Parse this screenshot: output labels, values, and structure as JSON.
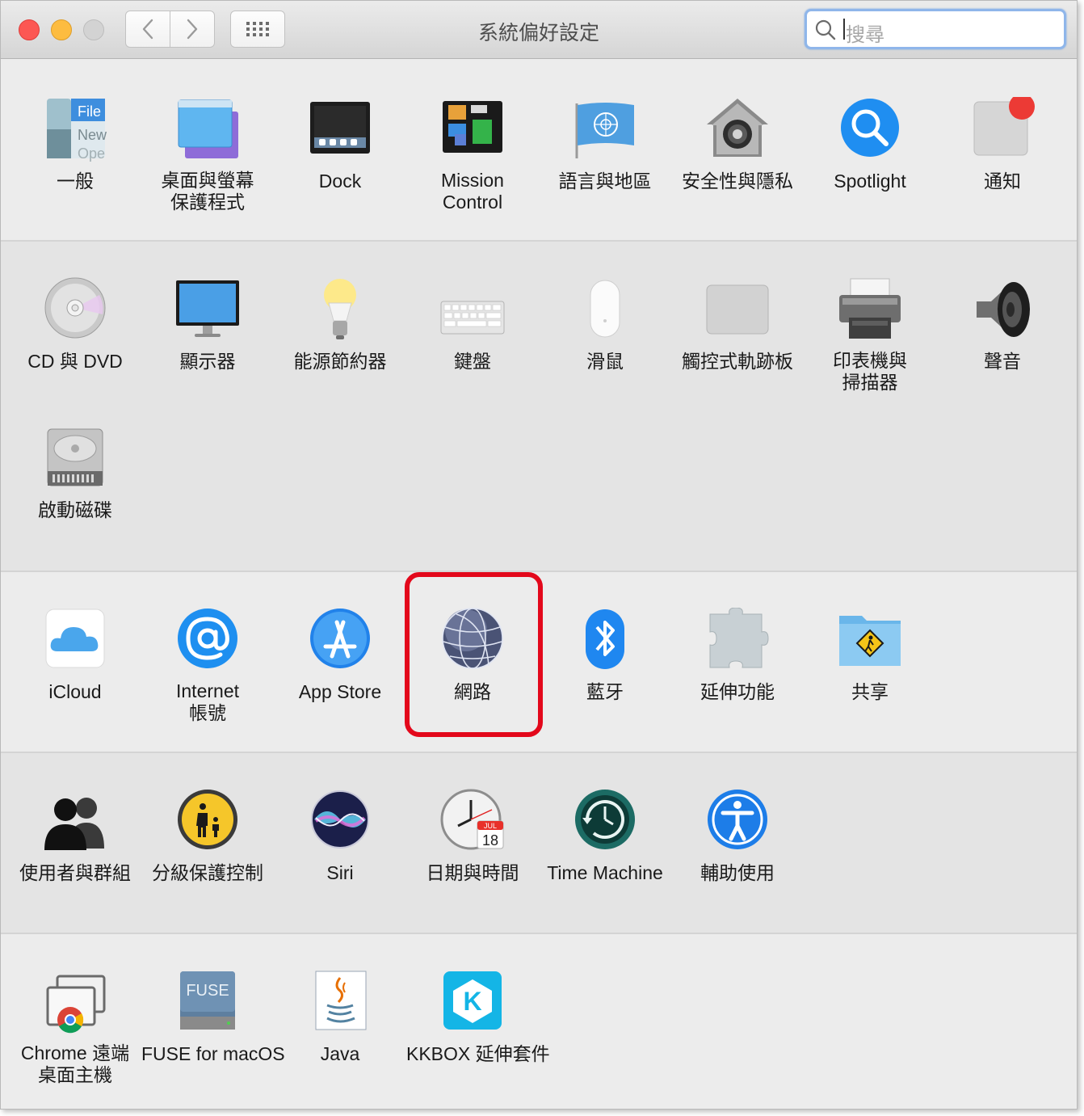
{
  "window": {
    "title": "系統偏好設定"
  },
  "search": {
    "placeholder": "搜尋"
  },
  "panes": {
    "general": "一般",
    "desktop": "桌面與螢幕\n保護程式",
    "dock": "Dock",
    "mission_control": "Mission\nControl",
    "language": "語言與地區",
    "security": "安全性與隱私",
    "spotlight": "Spotlight",
    "notifications": "通知",
    "cd_dvd": "CD 與 DVD",
    "displays": "顯示器",
    "energy": "能源節約器",
    "keyboard": "鍵盤",
    "mouse": "滑鼠",
    "trackpad": "觸控式軌跡板",
    "printers": "印表機與\n掃描器",
    "sound": "聲音",
    "startup_disk": "啟動磁碟",
    "icloud": "iCloud",
    "internet_accounts": "Internet\n帳號",
    "app_store": "App Store",
    "network": "網路",
    "bluetooth": "藍牙",
    "extensions": "延伸功能",
    "sharing": "共享",
    "users": "使用者與群組",
    "parental": "分級保護控制",
    "siri": "Siri",
    "date_time": "日期與時間",
    "time_machine": "Time Machine",
    "accessibility": "輔助使用",
    "chrome_remote": "Chrome 遠端\n桌面主機",
    "fuse": "FUSE for macOS",
    "java": "Java",
    "kkbox": "KKBOX 延伸套件"
  },
  "icon_text": {
    "general_file": "File",
    "general_new": "New",
    "general_open": "Ope",
    "fuse_label": "FUSE",
    "calendar_month": "JUL",
    "calendar_day": "18",
    "kkbox_letter": "K"
  },
  "colors": {
    "highlight": "#e3081b",
    "accent": "#1e8ff0"
  }
}
